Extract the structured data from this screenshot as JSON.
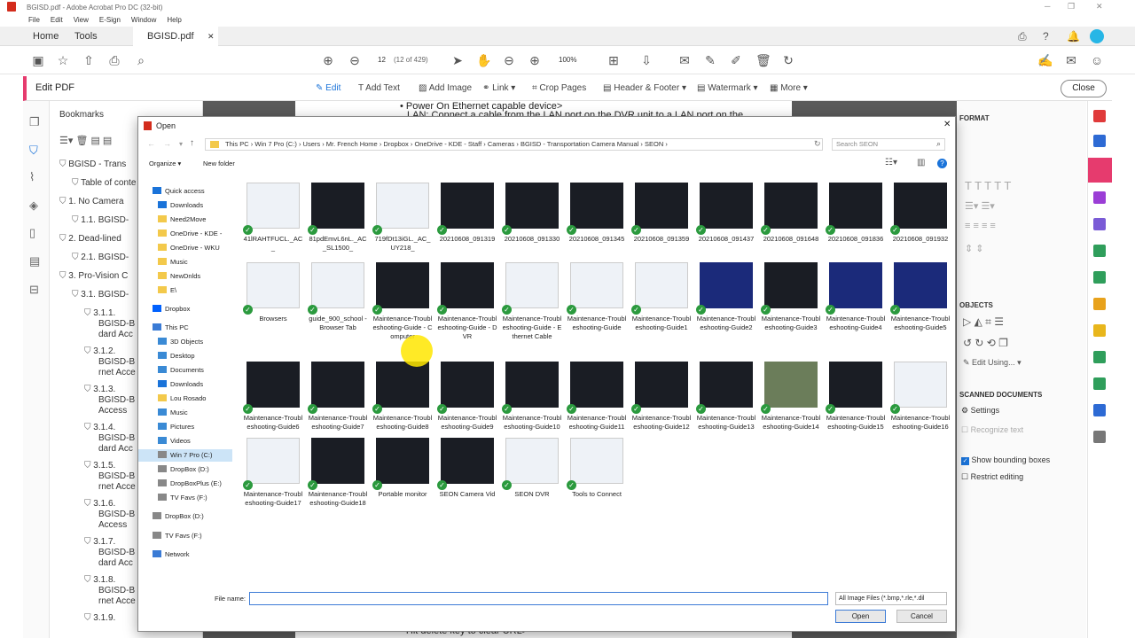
{
  "window": {
    "title": "BGISD.pdf - Adobe Acrobat Pro DC (32-bit)"
  },
  "menubar": [
    "File",
    "Edit",
    "View",
    "E-Sign",
    "Window",
    "Help"
  ],
  "tabs": {
    "home": "Home",
    "tools": "Tools",
    "document": "BGISD.pdf"
  },
  "toolbar": {
    "page_number": "12",
    "page_count": "(12 of 429)",
    "zoom": "100%"
  },
  "editbar": {
    "title": "Edit PDF",
    "edit": "Edit",
    "add_text": "Add Text",
    "add_image": "Add Image",
    "link": "Link",
    "crop": "Crop Pages",
    "header_footer": "Header & Footer",
    "watermark": "Watermark",
    "more": "More",
    "close": "Close"
  },
  "bookmarks": {
    "title": "Bookmarks",
    "items": [
      {
        "label": "BGISD - Trans"
      },
      {
        "label": "Table of conte"
      },
      {
        "label": "1. No Camera"
      },
      {
        "label": "1.1. BGISD-"
      },
      {
        "label": "2. Dead-lined"
      },
      {
        "label": "2.1. BGISD-"
      },
      {
        "label": "3. Pro-Vision C"
      },
      {
        "label": "3.1. BGISD-"
      },
      {
        "label": "3.1.1.",
        "sub": [
          "BGISD-B",
          "dard Acc"
        ]
      },
      {
        "label": "3.1.2.",
        "sub": [
          "BGISD-B",
          "rnet Acce"
        ]
      },
      {
        "label": "3.1.3.",
        "sub": [
          "BGISD-B",
          "Access"
        ]
      },
      {
        "label": "3.1.4.",
        "sub": [
          "BGISD-B",
          "dard Acc"
        ]
      },
      {
        "label": "3.1.5.",
        "sub": [
          "BGISD-B",
          "rnet Acce"
        ]
      },
      {
        "label": "3.1.6.",
        "sub": [
          "BGISD-B",
          "Access"
        ]
      },
      {
        "label": "3.1.7.",
        "sub": [
          "BGISD-B",
          "dard Acc"
        ]
      },
      {
        "label": "3.1.8.",
        "sub": [
          "BGISD-B",
          "rnet Acce"
        ]
      },
      {
        "label": "3.1.9.",
        "sub": []
      }
    ]
  },
  "pdf": {
    "line1": "• Power On Ethernet capable device>",
    "line2": "LAN: Connect a cable from the LAN port on the DVR unit to a LAN port on the",
    "line_bottom": "• Hit delete key to clear URL>"
  },
  "right_panel": {
    "format": "FORMAT",
    "objects": "OBJECTS",
    "edit_using": "Edit Using...",
    "scanned": "SCANNED DOCUMENTS",
    "settings": "Settings",
    "recognize": "Recognize text",
    "show_bounding": "Show bounding boxes",
    "restrict": "Restrict editing"
  },
  "dialog": {
    "title": "Open",
    "path": [
      "This PC",
      "Win 7 Pro (C:)",
      "Users",
      "Mr. French Home",
      "Dropbox",
      "OneDrive - KDE - Staff",
      "Cameras",
      "BGISD - Transportation Camera Manual",
      "SEON"
    ],
    "search_placeholder": "Search SEON",
    "organize": "Organize ▾",
    "new_folder": "New folder",
    "nav": [
      {
        "label": "Quick access",
        "kind": "star"
      },
      {
        "label": "Downloads",
        "kind": "down"
      },
      {
        "label": "Need2Move",
        "kind": "folder"
      },
      {
        "label": "OneDrive - KDE -",
        "kind": "folder"
      },
      {
        "label": "OneDrive - WKU",
        "kind": "folder"
      },
      {
        "label": "Music",
        "kind": "folder"
      },
      {
        "label": "NewDnlds",
        "kind": "folder"
      },
      {
        "label": "E\\",
        "kind": "folder"
      },
      {
        "label": "Dropbox",
        "kind": "dropbox"
      },
      {
        "label": "This PC",
        "kind": "pc"
      },
      {
        "label": "3D Objects",
        "kind": "blue"
      },
      {
        "label": "Desktop",
        "kind": "blue"
      },
      {
        "label": "Documents",
        "kind": "blue"
      },
      {
        "label": "Downloads",
        "kind": "down"
      },
      {
        "label": "Lou Rosado",
        "kind": "folder"
      },
      {
        "label": "Music",
        "kind": "blue"
      },
      {
        "label": "Pictures",
        "kind": "blue"
      },
      {
        "label": "Videos",
        "kind": "blue"
      },
      {
        "label": "Win 7 Pro (C:)",
        "kind": "drive"
      },
      {
        "label": "DropBox (D:)",
        "kind": "drive"
      },
      {
        "label": "DropBoxPlus (E:)",
        "kind": "drive"
      },
      {
        "label": "TV Favs (F:)",
        "kind": "drive"
      },
      {
        "label": "DropBox (D:)",
        "kind": "drive"
      },
      {
        "label": "TV Favs (F:)",
        "kind": "drive"
      },
      {
        "label": "Network",
        "kind": "net"
      }
    ],
    "files": [
      {
        "name": "41lRAHTFUCL._AC_",
        "thumb": "photo"
      },
      {
        "name": "81pdEmvL6nL._AC_SL1500_",
        "thumb": "monitor"
      },
      {
        "name": "719fDt13iGL._AC_UY218_",
        "thumb": "cable"
      },
      {
        "name": "20210608_091319",
        "thumb": "dark"
      },
      {
        "name": "20210608_091330",
        "thumb": "dark"
      },
      {
        "name": "20210608_091345",
        "thumb": "dark"
      },
      {
        "name": "20210608_091359",
        "thumb": "dark"
      },
      {
        "name": "20210608_091437",
        "thumb": "dark"
      },
      {
        "name": "20210608_091648",
        "thumb": "dark"
      },
      {
        "name": "20210608_091836",
        "thumb": "dark"
      },
      {
        "name": "20210608_091932",
        "thumb": "dark"
      },
      {
        "name": "Browsers",
        "thumb": "light"
      },
      {
        "name": "guide_900_school - Browser Tab",
        "thumb": "light"
      },
      {
        "name": "Maintenance-Troubleshooting-Guide - Computer",
        "thumb": "laptop"
      },
      {
        "name": "Maintenance-Troubleshooting-Guide - DVR",
        "thumb": "dvr"
      },
      {
        "name": "Maintenance-Troubleshooting-Guide - Ethernet Cable",
        "thumb": "light"
      },
      {
        "name": "Maintenance-Troubleshooting-Guide",
        "thumb": "light"
      },
      {
        "name": "Maintenance-Troubleshooting-Guide1",
        "thumb": "light"
      },
      {
        "name": "Maintenance-Troubleshooting-Guide2",
        "thumb": "blue"
      },
      {
        "name": "Maintenance-Troubleshooting-Guide3",
        "thumb": "dark"
      },
      {
        "name": "Maintenance-Troubleshooting-Guide4",
        "thumb": "blue"
      },
      {
        "name": "Maintenance-Troubleshooting-Guide5",
        "thumb": "blue"
      },
      {
        "name": "Maintenance-Troubleshooting-Guide6",
        "thumb": "dark"
      },
      {
        "name": "Maintenance-Troubleshooting-Guide7",
        "thumb": "dark"
      },
      {
        "name": "Maintenance-Troubleshooting-Guide8",
        "thumb": "dark"
      },
      {
        "name": "Maintenance-Troubleshooting-Guide9",
        "thumb": "dark"
      },
      {
        "name": "Maintenance-Troubleshooting-Guide10",
        "thumb": "dark"
      },
      {
        "name": "Maintenance-Troubleshooting-Guide11",
        "thumb": "dark"
      },
      {
        "name": "Maintenance-Troubleshooting-Guide12",
        "thumb": "dark"
      },
      {
        "name": "Maintenance-Troubleshooting-Guide13",
        "thumb": "dark"
      },
      {
        "name": "Maintenance-Troubleshooting-Guide14",
        "thumb": "street"
      },
      {
        "name": "Maintenance-Troubleshooting-Guide15",
        "thumb": "dark"
      },
      {
        "name": "Maintenance-Troubleshooting-Guide16",
        "thumb": "light"
      },
      {
        "name": "Maintenance-Troubleshooting-Guide17",
        "thumb": "light"
      },
      {
        "name": "Maintenance-Troubleshooting-Guide18",
        "thumb": "dvr"
      },
      {
        "name": "Portable monitor",
        "thumb": "monitor"
      },
      {
        "name": "SEON Camera Vid",
        "thumb": "dark"
      },
      {
        "name": "SEON DVR",
        "thumb": "light"
      },
      {
        "name": "Tools to Connect",
        "thumb": "light"
      }
    ],
    "file_name_label": "File name:",
    "file_name_value": "",
    "file_type": "All Image Files (*.bmp,*.rle,*.dil",
    "open": "Open",
    "cancel": "Cancel"
  },
  "colors": {
    "accent": "#e63b6e",
    "blue": "#1a73d9",
    "check": "#2b9a3e"
  }
}
